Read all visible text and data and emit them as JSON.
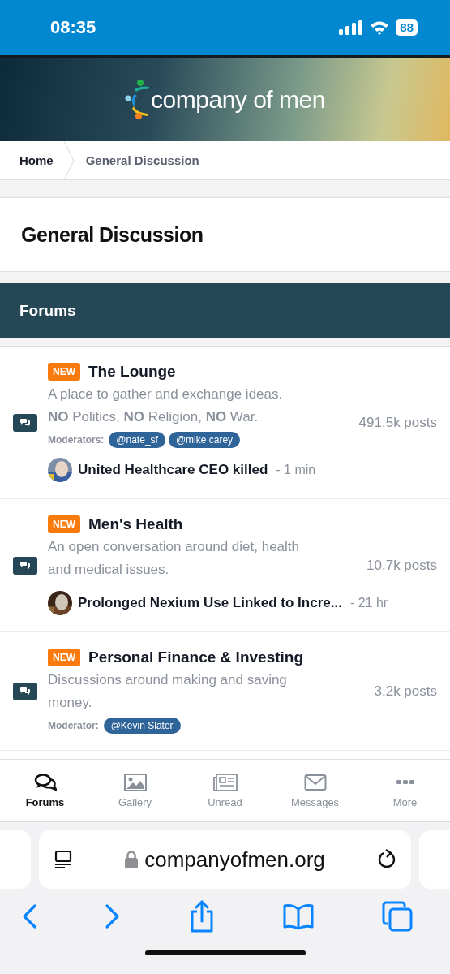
{
  "status_bar": {
    "time": "08:35",
    "battery": "88"
  },
  "site": {
    "logo_text": "company of men"
  },
  "breadcrumbs": [
    {
      "label": "Home",
      "selected": false
    },
    {
      "label": "General Discussion",
      "selected": true
    }
  ],
  "page_title": "General Discussion",
  "section": {
    "title": "Forums"
  },
  "forums": [
    {
      "badge": "NEW",
      "title": "The Lounge",
      "description": [
        "A place to gather and exchange ideas.",
        "**NO** Politics, **NO** Religion, **NO** War."
      ],
      "posts": "491.5k posts",
      "moderators_label": "Moderators:",
      "moderators": [
        "@nate_sf",
        "@mike carey"
      ],
      "last_post": {
        "title": "United Healthcare CEO killed",
        "time": "- 1 min"
      }
    },
    {
      "badge": "NEW",
      "title": "Men's Health",
      "description": [
        "An open conversation around diet, health",
        "and medical issues."
      ],
      "posts": "10.7k posts",
      "last_post": {
        "title": "Prolonged Nexium Use Linked to Incre...",
        "time": "- 21 hr"
      }
    },
    {
      "badge": "NEW",
      "title": "Personal Finance & Investing",
      "description": [
        "Discussions around making and saving",
        "money."
      ],
      "posts": "3.2k posts",
      "moderators_label": "Moderator:",
      "moderators": [
        "@Kevin Slater"
      ]
    }
  ],
  "bottom_nav": [
    {
      "label": "Forums",
      "kind": "forums",
      "selected": true
    },
    {
      "label": "Gallery",
      "kind": "gallery",
      "selected": false
    },
    {
      "label": "Unread",
      "kind": "unread",
      "selected": false
    },
    {
      "label": "Messages",
      "kind": "messages",
      "selected": false
    },
    {
      "label": "More",
      "kind": "more",
      "selected": false
    }
  ],
  "browser": {
    "url": "companyofmen.org"
  }
}
